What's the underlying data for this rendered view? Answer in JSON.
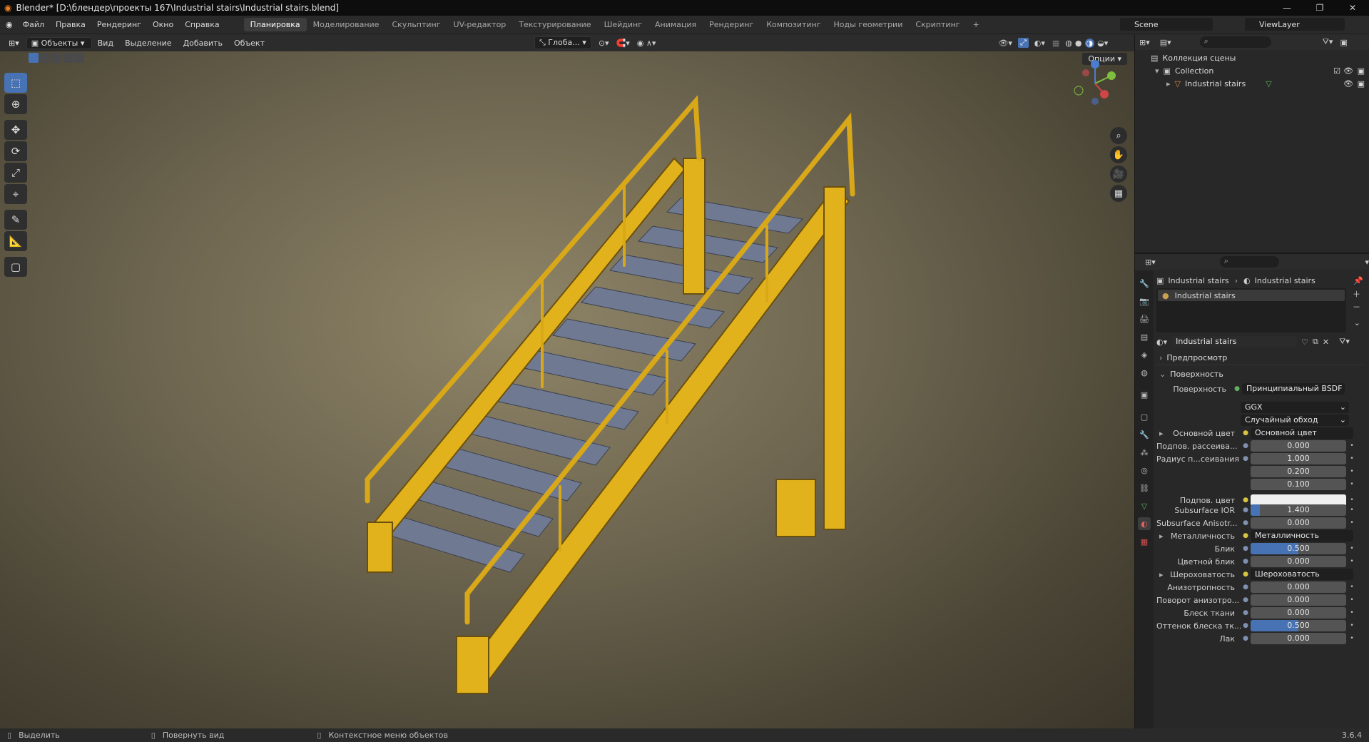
{
  "window": {
    "title": "Blender* [D:\\блендер\\проекты 167\\Industrial stairs\\Industrial stairs.blend]",
    "minimize": "—",
    "restore": "❐",
    "close": "✕"
  },
  "menu": [
    "Файл",
    "Правка",
    "Рендеринг",
    "Окно",
    "Справка"
  ],
  "workspaces": [
    "Планировка",
    "Моделирование",
    "Скульптинг",
    "UV-редактор",
    "Текстурирование",
    "Шейдинг",
    "Анимация",
    "Рендеринг",
    "Композитинг",
    "Ноды геометрии",
    "Скриптинг",
    "+"
  ],
  "scene": {
    "name": "Scene",
    "viewlayer": "ViewLayer"
  },
  "viewport_header": {
    "mode": "Объекты",
    "view": "Вид",
    "select": "Выделение",
    "add": "Добавить",
    "object": "Объект",
    "orientation": "Глоба...",
    "options": "Опции"
  },
  "outliner": {
    "root": "Коллекция сцены",
    "collection": "Collection",
    "object": "Industrial stairs"
  },
  "properties": {
    "breadcrumb_obj": "Industrial stairs",
    "breadcrumb_mat": "Industrial stairs",
    "slot": "Industrial stairs",
    "material_name": "Industrial stairs",
    "preview": "Предпросмотр",
    "surface_section": "Поверхность",
    "surface_label": "Поверхность",
    "surface_value": "Принципиальный BSDF",
    "distribution": "GGX",
    "subsurface_method": "Случайный обход",
    "rows": [
      {
        "label": "Основной цвет",
        "value": "Основной цвет",
        "kind": "link"
      },
      {
        "label": "Подпов. рассеива...",
        "value": "0.000",
        "kind": "num"
      },
      {
        "label": "Радиус п...сеивания",
        "value": "1.000",
        "kind": "num"
      },
      {
        "label": "",
        "value": "0.200",
        "kind": "num"
      },
      {
        "label": "",
        "value": "0.100",
        "kind": "num"
      },
      {
        "label": "Подпов. цвет",
        "value": "",
        "kind": "color"
      },
      {
        "label": "Subsurface IOR",
        "value": "1.400",
        "kind": "num",
        "fill": 0.1
      },
      {
        "label": "Subsurface Anisotr...",
        "value": "0.000",
        "kind": "num"
      },
      {
        "label": "Металличность",
        "value": "Металличность",
        "kind": "link"
      },
      {
        "label": "Блик",
        "value": "0.500",
        "kind": "num",
        "fill": 0.5
      },
      {
        "label": "Цветной блик",
        "value": "0.000",
        "kind": "num"
      },
      {
        "label": "Шероховатость",
        "value": "Шероховатость",
        "kind": "link"
      },
      {
        "label": "Анизотропность",
        "value": "0.000",
        "kind": "num"
      },
      {
        "label": "Поворот анизотро...",
        "value": "0.000",
        "kind": "num"
      },
      {
        "label": "Блеск ткани",
        "value": "0.000",
        "kind": "num"
      },
      {
        "label": "Оттенок блеска тк...",
        "value": "0.500",
        "kind": "num",
        "fill": 0.5
      },
      {
        "label": "Лак",
        "value": "0.000",
        "kind": "num"
      }
    ]
  },
  "status": {
    "select": "Выделить",
    "rotate": "Повернуть вид",
    "context": "Контекстное меню объектов",
    "version": "3.6.4"
  },
  "colors": {
    "accent": "#4772b3",
    "stair_yellow": "#e2b21c"
  }
}
